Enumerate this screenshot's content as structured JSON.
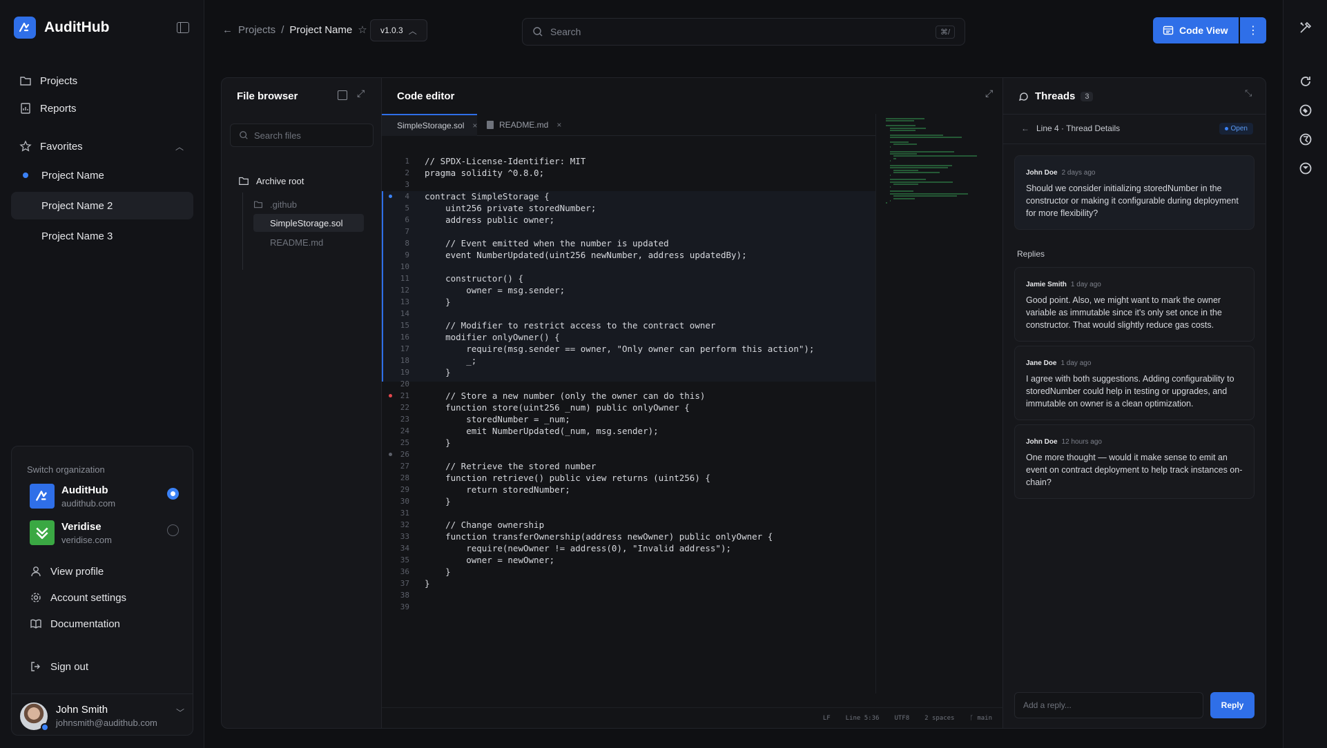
{
  "app": {
    "name": "AuditHub",
    "accent": "#2f6fe8"
  },
  "sidebar": {
    "nav": [
      {
        "label": "Projects",
        "icon": "folder-icon"
      },
      {
        "label": "Reports",
        "icon": "report-icon"
      }
    ],
    "favorites": {
      "label": "Favorites",
      "items": [
        {
          "label": "Project Name",
          "active_dot": true
        },
        {
          "label": "Project Name 2",
          "hovered": true
        },
        {
          "label": "Project Name 3"
        }
      ]
    },
    "org_switcher": {
      "label": "Switch organization",
      "orgs": [
        {
          "name": "AuditHub",
          "domain": "audithub.com",
          "selected": true,
          "color": "#2f6fe8"
        },
        {
          "name": "Veridise",
          "domain": "veridise.com",
          "selected": false,
          "color": "#3aa843"
        }
      ],
      "menu": [
        {
          "label": "View profile",
          "icon": "user-icon"
        },
        {
          "label": "Account settings",
          "icon": "gear-icon"
        },
        {
          "label": "Documentation",
          "icon": "book-icon"
        },
        {
          "label": "Sign out",
          "icon": "sign-out-icon"
        }
      ],
      "user": {
        "name": "John Smith",
        "email": "johnsmith@audithub.com"
      }
    }
  },
  "topbar": {
    "breadcrumb": {
      "parent": "Projects",
      "current": "Project Name"
    },
    "version": "v1.0.3",
    "search": {
      "placeholder": "Search",
      "shortcut": "⌘/"
    },
    "code_view_label": "Code View"
  },
  "file_browser": {
    "title": "File browser",
    "search_placeholder": "Search files",
    "root": "Archive root",
    "items": [
      {
        "label": ".github",
        "type": "folder"
      },
      {
        "label": "SimpleStorage.sol",
        "type": "file",
        "selected": true
      },
      {
        "label": "README.md",
        "type": "file"
      }
    ]
  },
  "editor": {
    "title": "Code editor",
    "tabs": [
      {
        "label": "SimpleStorage.sol",
        "active": true
      },
      {
        "label": "README.md",
        "active": false
      }
    ],
    "lines": [
      "// SPDX-License-Identifier: MIT",
      "pragma solidity ^0.8.0;",
      "",
      "contract SimpleStorage {",
      "    uint256 private storedNumber;",
      "    address public owner;",
      "",
      "    // Event emitted when the number is updated",
      "    event NumberUpdated(uint256 newNumber, address updatedBy);",
      "",
      "    constructor() {",
      "        owner = msg.sender;",
      "    }",
      "",
      "    // Modifier to restrict access to the contract owner",
      "    modifier onlyOwner() {",
      "        require(msg.sender == owner, \"Only owner can perform this action\");",
      "        _;",
      "    }",
      "",
      "    // Store a new number (only the owner can do this)",
      "    function store(uint256 _num) public onlyOwner {",
      "        storedNumber = _num;",
      "        emit NumberUpdated(_num, msg.sender);",
      "    }",
      "",
      "    // Retrieve the stored number",
      "    function retrieve() public view returns (uint256) {",
      "        return storedNumber;",
      "    }",
      "",
      "    // Change ownership",
      "    function transferOwnership(address newOwner) public onlyOwner {",
      "        require(newOwner != address(0), \"Invalid address\");",
      "        owner = newOwner;",
      "    }",
      "}",
      "",
      ""
    ],
    "status": {
      "eol": "LF",
      "position": "Line 5:36",
      "encoding": "UTF8",
      "indent": "2 spaces",
      "branch": "main"
    }
  },
  "threads": {
    "title": "Threads",
    "count": "3",
    "subtitle": "Line 4 · Thread Details",
    "status": "Open",
    "root": {
      "author": "John Doe",
      "time": "2 days ago",
      "text": "Should we consider initializing storedNumber in the constructor or making it configurable during deployment for more flexibility?"
    },
    "replies_label": "Replies",
    "replies": [
      {
        "author": "Jamie Smith",
        "time": "1 day ago",
        "text": "Good point. Also, we might want to mark the owner variable as immutable since it's only set once in the constructor. That would slightly reduce gas costs."
      },
      {
        "author": "Jane Doe",
        "time": "1 day ago",
        "text": "I agree with both suggestions. Adding configurability to storedNumber could help in testing or upgrades, and immutable on owner is a clean optimization."
      },
      {
        "author": "John Doe",
        "time": "12 hours ago",
        "text": "One more thought — would it make sense to emit an event on contract deployment to help track instances on-chain?"
      }
    ],
    "reply_placeholder": "Add a reply...",
    "reply_label": "Reply"
  }
}
